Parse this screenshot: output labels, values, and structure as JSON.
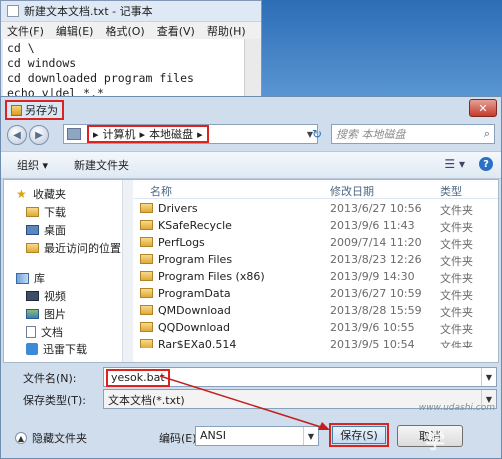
{
  "notepad": {
    "title": "新建文本文档.txt - 记事本",
    "menu": [
      "文件(F)",
      "编辑(E)",
      "格式(O)",
      "查看(V)",
      "帮助(H)"
    ],
    "lines": [
      "cd \\",
      "cd windows",
      "cd downloaded program files",
      "echo y|del *.*"
    ]
  },
  "dialog": {
    "title": "另存为",
    "close_label": "✕",
    "breadcrumbs": [
      "计算机",
      "本地磁盘"
    ],
    "search_placeholder": "搜索 本地磁盘",
    "toolbar": {
      "organize": "组织 ▾",
      "new_folder": "新建文件夹"
    },
    "nav": {
      "favorites": "收藏夹",
      "downloads": "下载",
      "desktop": "桌面",
      "recent": "最近访问的位置",
      "libraries": "库",
      "videos": "视频",
      "pictures": "图片",
      "documents": "文档",
      "thunder": "迅雷下载"
    },
    "columns": {
      "name": "名称",
      "date": "修改日期",
      "type": "类型"
    },
    "files": [
      {
        "name": "Drivers",
        "date": "2013/6/27 10:56",
        "type": "文件夹"
      },
      {
        "name": "KSafeRecycle",
        "date": "2013/9/6 11:43",
        "type": "文件夹"
      },
      {
        "name": "PerfLogs",
        "date": "2009/7/14 11:20",
        "type": "文件夹"
      },
      {
        "name": "Program Files",
        "date": "2013/8/23 12:26",
        "type": "文件夹"
      },
      {
        "name": "Program Files (x86)",
        "date": "2013/9/9 14:30",
        "type": "文件夹"
      },
      {
        "name": "ProgramData",
        "date": "2013/6/27 10:59",
        "type": "文件夹"
      },
      {
        "name": "QMDownload",
        "date": "2013/8/28 15:59",
        "type": "文件夹"
      },
      {
        "name": "QQDownload",
        "date": "2013/9/6 10:55",
        "type": "文件夹"
      },
      {
        "name": "Rar$EXa0.514",
        "date": "2013/9/5 10:54",
        "type": "文件夹"
      }
    ],
    "filename_label": "文件名(N):",
    "filename_value": "yesok.bat",
    "filetype_label": "保存类型(T):",
    "filetype_value": "文本文档(*.txt)",
    "hide_folders": "隐藏文件夹",
    "encoding_label": "编码(E):",
    "encoding_value": "ANSI",
    "save_label": "保存(S)",
    "cancel_label": "取消",
    "watermark": "学",
    "watermark_url": "www.udashi.com"
  },
  "colors": {
    "highlight": "#dd2222",
    "arrow": "#c41e1e"
  }
}
